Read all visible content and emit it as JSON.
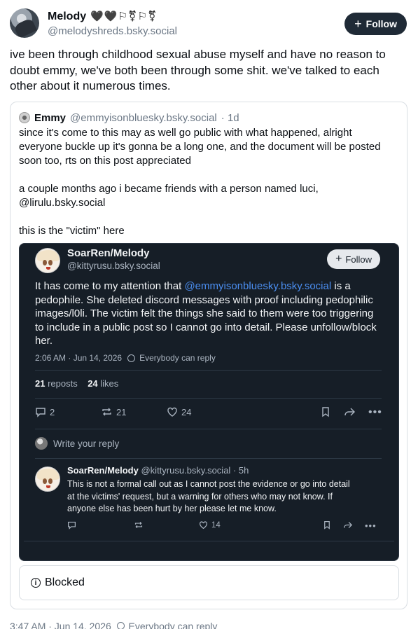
{
  "post": {
    "author_name": "Melody",
    "author_flags": "🖤🖤⚐⚧⚐⚧",
    "author_handle": "@melodyshreds.bsky.social",
    "follow_label": "Follow",
    "text": "ive been through childhood sexual abuse myself and have no reason to doubt emmy, we've both been through some shit. we've talked to each other about it numerous times.",
    "timestamp": "3:47 AM · Jun 14, 2026",
    "visibility": "Everybody can reply"
  },
  "quote": {
    "author_name": "Emmy",
    "author_handle": "@emmyisonbluesky.bsky.social",
    "age": "· 1d",
    "text": "since it's come to this may as well go public with what happened, alright everyone buckle up it's gonna be a long one, and the document will be posted soon too, rts on this post appreciated\n\na couple months ago i became friends with a person named luci, @lirulu.bsky.social\n\nthis is the \"victim\" here",
    "blocked_label": "Blocked"
  },
  "embed": {
    "author_name": "SoarRen/Melody",
    "author_handle": "@kittyrusu.bsky.social",
    "follow_label": "Follow",
    "text_before": "It has come to my attention that ",
    "mention": "@emmyisonbluesky.bsky.social",
    "text_after": " is a pedophile. She deleted discord messages with proof including pedophilic images/l0li. The victim felt the things she said to them were too triggering to include in a public post so I cannot go into detail. Please unfollow/block her.",
    "timestamp": "2:06 AM · Jun 14, 2026",
    "visibility": "Everybody can reply",
    "reposts_count": "21",
    "reposts_label": "reposts",
    "likes_count": "24",
    "likes_label": "likes",
    "actions": {
      "replies": "2",
      "reposts": "21",
      "likes": "24"
    },
    "reply_placeholder": "Write your reply",
    "reply": {
      "author_name": "SoarRen/Melody",
      "author_handle": "@kittyrusu.bsky.social",
      "age": "· 5h",
      "text": "This is not a formal call out as I cannot post the evidence or go into detail at the victims' request, but a warning for others who may not know. If anyone else has been hurt by her please let me know.",
      "likes": "14"
    }
  },
  "colors": {
    "accent": "#4b8ef0",
    "follow_bg": "#1f2a36",
    "embed_bg": "#161e27"
  },
  "icons": [
    "reply-icon",
    "repost-icon",
    "heart-icon",
    "bookmark-icon",
    "share-icon",
    "more-icon",
    "globe-icon",
    "info-icon"
  ]
}
